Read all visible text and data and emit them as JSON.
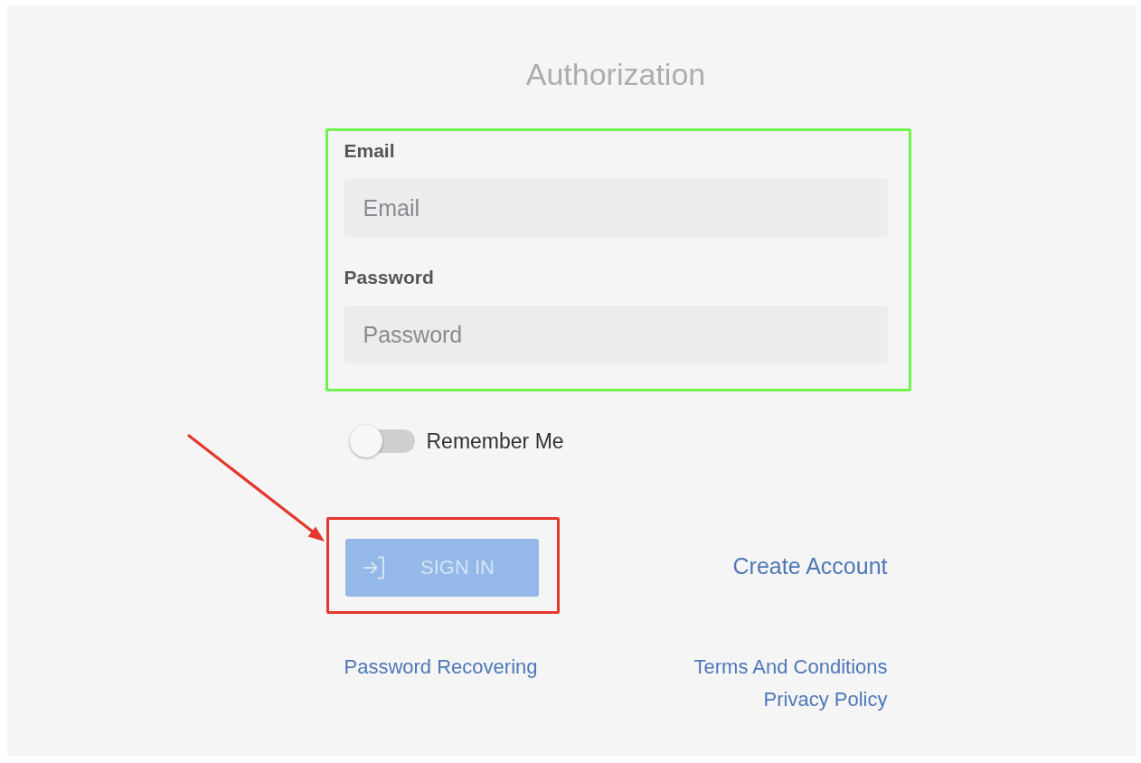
{
  "title": "Authorization",
  "form": {
    "highlighted": true,
    "fields": [
      {
        "label": "Email",
        "placeholder": "Email"
      },
      {
        "label": "Password",
        "placeholder": "Password"
      }
    ]
  },
  "remember_me": {
    "label": "Remember Me",
    "on": false
  },
  "sign_in": {
    "label": "SIGN IN",
    "disabled": true,
    "highlighted": true,
    "pointed_at": true
  },
  "create_account": "Create Account",
  "password_recovering": "Password Recovering",
  "legal_links": [
    "Terms And Conditions",
    "Privacy Policy"
  ]
}
